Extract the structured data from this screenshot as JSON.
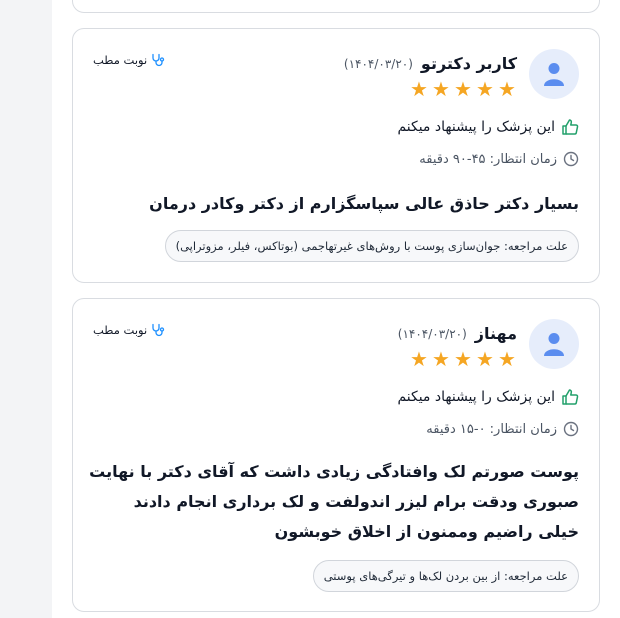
{
  "colors": {
    "star": "#f5a623",
    "thumb": "#22a06b",
    "accent": "#1e90ff",
    "avatar_bg": "#e6edfb",
    "avatar_fg": "#5b8def"
  },
  "reviews": [
    {
      "name": "کاربر دکترتو",
      "date": "(۱۴۰۴/۰۳/۲۰)",
      "rating": 5,
      "clinic_label": "نوبت مطب",
      "recommend": "این پزشک را پیشنهاد میکنم",
      "wait_time": "زمان انتظار: ۴۵-۹۰ دقیقه",
      "comment": "بسیار دکتر حاذق عالی سپاسگزارم از دکتر وکادر درمان",
      "reason_label": "علت مراجعه:",
      "reason": "جوان‌سازی پوست با روش‌های غیرتهاجمی (بوتاکس، فیلر، مزوتراپی)"
    },
    {
      "name": "مهناز",
      "date": "(۱۴۰۴/۰۳/۲۰)",
      "rating": 5,
      "clinic_label": "نوبت مطب",
      "recommend": "این پزشک را پیشنهاد میکنم",
      "wait_time": "زمان انتظار: ۰-۱۵ دقیقه",
      "comment": "پوست صورتم لک وافتادگی زیادی داشت که آقای دکتر با نهایت صبوری ودقت برام لیزر اندولفت و لک برداری انجام دادند خیلی راضیم وممنون از اخلاق خوبشون",
      "reason_label": "علت مراجعه:",
      "reason": "از بین بردن لک‌ها و تیرگی‌های پوستی"
    }
  ]
}
